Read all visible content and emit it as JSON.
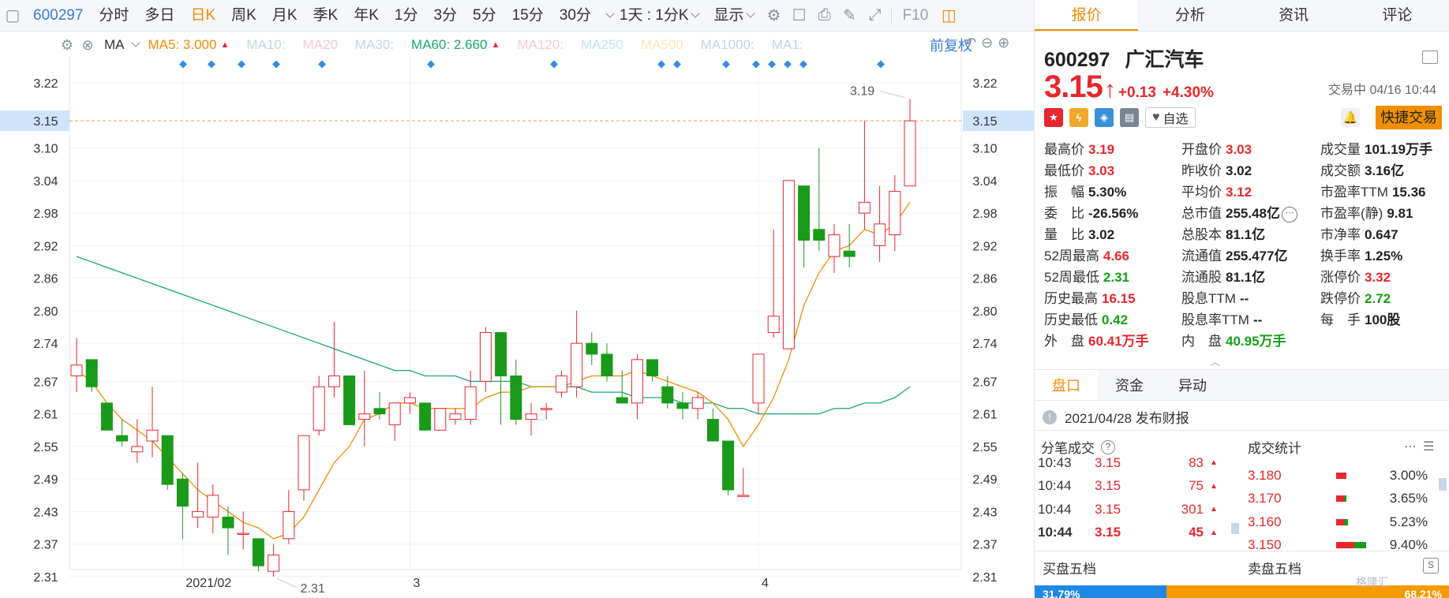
{
  "toolbar": {
    "code": "600297",
    "items": [
      "分时",
      "多日",
      "日K",
      "周K",
      "月K",
      "季K",
      "年K",
      "1分",
      "3分",
      "5分",
      "15分",
      "30分"
    ],
    "active": "日K",
    "interval": "1天 : 1分K",
    "display": "显示",
    "f10": "F10"
  },
  "ma_row": {
    "label": "MA",
    "items": [
      {
        "text": "MA5: 3.000",
        "color": "#f08c00",
        "arrow": true
      },
      {
        "text": "MA10:",
        "color": "#c8d2e6",
        "arrow": false
      },
      {
        "text": "MA20",
        "color": "#f3c9d8",
        "arrow": false
      },
      {
        "text": "MA30:",
        "color": "#c8d2e6",
        "arrow": false
      },
      {
        "text": "MA60: 2.660",
        "color": "#19a86e",
        "arrow": true
      },
      {
        "text": "MA120:",
        "color": "#f3c9d8",
        "arrow": false
      },
      {
        "text": "MA250",
        "color": "#bfe6f3",
        "arrow": false
      },
      {
        "text": "MA500",
        "color": "#f6e6b8",
        "arrow": false
      },
      {
        "text": "MA1000:",
        "color": "#c8d2e6",
        "arrow": false
      },
      {
        "text": "MA1:",
        "color": "#c8d2e6",
        "arrow": false
      }
    ],
    "restore": "前复权"
  },
  "chart_data": {
    "type": "candlestick",
    "y_ticks": [
      "3.22",
      "3.10",
      "3.04",
      "2.98",
      "2.92",
      "2.86",
      "2.80",
      "2.74",
      "2.67",
      "2.61",
      "2.55",
      "2.49",
      "2.43",
      "2.37",
      "2.31"
    ],
    "current_price": "3.15",
    "x_labels": [
      {
        "text": "2021/02",
        "index": 7
      },
      {
        "text": "3",
        "index": 22
      },
      {
        "text": "4",
        "index": 45
      }
    ],
    "high_label": "3.19",
    "low_label": "2.31",
    "candles": [
      {
        "o": 2.68,
        "h": 2.75,
        "l": 2.65,
        "c": 2.7
      },
      {
        "o": 2.71,
        "h": 2.71,
        "l": 2.65,
        "c": 2.66
      },
      {
        "o": 2.63,
        "h": 2.63,
        "l": 2.58,
        "c": 2.58
      },
      {
        "o": 2.57,
        "h": 2.6,
        "l": 2.55,
        "c": 2.56
      },
      {
        "o": 2.54,
        "h": 2.6,
        "l": 2.52,
        "c": 2.55
      },
      {
        "o": 2.56,
        "h": 2.66,
        "l": 2.53,
        "c": 2.58
      },
      {
        "o": 2.57,
        "h": 2.57,
        "l": 2.47,
        "c": 2.48
      },
      {
        "o": 2.49,
        "h": 2.5,
        "l": 2.38,
        "c": 2.44
      },
      {
        "o": 2.42,
        "h": 2.52,
        "l": 2.4,
        "c": 2.43
      },
      {
        "o": 2.42,
        "h": 2.48,
        "l": 2.39,
        "c": 2.46
      },
      {
        "o": 2.42,
        "h": 2.44,
        "l": 2.35,
        "c": 2.4
      },
      {
        "o": 2.39,
        "h": 2.43,
        "l": 2.36,
        "c": 2.39
      },
      {
        "o": 2.38,
        "h": 2.38,
        "l": 2.32,
        "c": 2.33
      },
      {
        "o": 2.32,
        "h": 2.37,
        "l": 2.31,
        "c": 2.35
      },
      {
        "o": 2.38,
        "h": 2.47,
        "l": 2.37,
        "c": 2.43
      },
      {
        "o": 2.47,
        "h": 2.57,
        "l": 2.45,
        "c": 2.57
      },
      {
        "o": 2.58,
        "h": 2.68,
        "l": 2.57,
        "c": 2.66
      },
      {
        "o": 2.66,
        "h": 2.78,
        "l": 2.64,
        "c": 2.68
      },
      {
        "o": 2.68,
        "h": 2.68,
        "l": 2.59,
        "c": 2.59
      },
      {
        "o": 2.6,
        "h": 2.69,
        "l": 2.55,
        "c": 2.61
      },
      {
        "o": 2.62,
        "h": 2.65,
        "l": 2.6,
        "c": 2.61
      },
      {
        "o": 2.59,
        "h": 2.63,
        "l": 2.56,
        "c": 2.63
      },
      {
        "o": 2.63,
        "h": 2.65,
        "l": 2.61,
        "c": 2.64
      },
      {
        "o": 2.63,
        "h": 2.63,
        "l": 2.59,
        "c": 2.58
      },
      {
        "o": 2.58,
        "h": 2.62,
        "l": 2.58,
        "c": 2.62
      },
      {
        "o": 2.6,
        "h": 2.62,
        "l": 2.59,
        "c": 2.61
      },
      {
        "o": 2.6,
        "h": 2.69,
        "l": 2.59,
        "c": 2.66
      },
      {
        "o": 2.67,
        "h": 2.77,
        "l": 2.65,
        "c": 2.76
      },
      {
        "o": 2.76,
        "h": 2.76,
        "l": 2.59,
        "c": 2.68
      },
      {
        "o": 2.68,
        "h": 2.71,
        "l": 2.59,
        "c": 2.6
      },
      {
        "o": 2.6,
        "h": 2.63,
        "l": 2.57,
        "c": 2.61
      },
      {
        "o": 2.62,
        "h": 2.63,
        "l": 2.6,
        "c": 2.62
      },
      {
        "o": 2.65,
        "h": 2.69,
        "l": 2.64,
        "c": 2.68
      },
      {
        "o": 2.66,
        "h": 2.8,
        "l": 2.64,
        "c": 2.74
      },
      {
        "o": 2.74,
        "h": 2.76,
        "l": 2.7,
        "c": 2.72
      },
      {
        "o": 2.72,
        "h": 2.74,
        "l": 2.67,
        "c": 2.68
      },
      {
        "o": 2.64,
        "h": 2.69,
        "l": 2.63,
        "c": 2.63
      },
      {
        "o": 2.63,
        "h": 2.72,
        "l": 2.6,
        "c": 2.71
      },
      {
        "o": 2.71,
        "h": 2.71,
        "l": 2.67,
        "c": 2.68
      },
      {
        "o": 2.66,
        "h": 2.68,
        "l": 2.62,
        "c": 2.63
      },
      {
        "o": 2.63,
        "h": 2.65,
        "l": 2.6,
        "c": 2.62
      },
      {
        "o": 2.62,
        "h": 2.65,
        "l": 2.6,
        "c": 2.64
      },
      {
        "o": 2.6,
        "h": 2.62,
        "l": 2.56,
        "c": 2.56
      },
      {
        "o": 2.56,
        "h": 2.56,
        "l": 2.46,
        "c": 2.47
      },
      {
        "o": 2.46,
        "h": 2.51,
        "l": 2.46,
        "c": 2.46
      },
      {
        "o": 2.63,
        "h": 2.72,
        "l": 2.61,
        "c": 2.72
      },
      {
        "o": 2.76,
        "h": 2.95,
        "l": 2.75,
        "c": 2.79
      },
      {
        "o": 2.73,
        "h": 3.04,
        "l": 2.73,
        "c": 3.04
      },
      {
        "o": 3.03,
        "h": 3.03,
        "l": 2.88,
        "c": 2.93
      },
      {
        "o": 2.95,
        "h": 3.1,
        "l": 2.91,
        "c": 2.93
      },
      {
        "o": 2.9,
        "h": 2.96,
        "l": 2.87,
        "c": 2.94
      },
      {
        "o": 2.91,
        "h": 2.96,
        "l": 2.88,
        "c": 2.9
      },
      {
        "o": 2.98,
        "h": 3.15,
        "l": 2.95,
        "c": 3.0
      },
      {
        "o": 2.92,
        "h": 3.03,
        "l": 2.89,
        "c": 2.96
      },
      {
        "o": 2.94,
        "h": 3.05,
        "l": 2.91,
        "c": 3.02
      },
      {
        "o": 3.03,
        "h": 3.19,
        "l": 3.03,
        "c": 3.15
      }
    ],
    "ma5": [
      2.69,
      2.67,
      2.63,
      2.6,
      2.58,
      2.56,
      2.53,
      2.5,
      2.47,
      2.45,
      2.43,
      2.41,
      2.4,
      2.38,
      2.39,
      2.42,
      2.47,
      2.52,
      2.55,
      2.6,
      2.61,
      2.63,
      2.63,
      2.62,
      2.62,
      2.62,
      2.62,
      2.64,
      2.65,
      2.65,
      2.66,
      2.66,
      2.66,
      2.67,
      2.68,
      2.68,
      2.68,
      2.69,
      2.68,
      2.67,
      2.66,
      2.65,
      2.63,
      2.6,
      2.55,
      2.59,
      2.64,
      2.71,
      2.81,
      2.87,
      2.91,
      2.92,
      2.95,
      2.94,
      2.96,
      3.0
    ],
    "ma60": [
      2.9,
      2.89,
      2.88,
      2.87,
      2.86,
      2.85,
      2.84,
      2.83,
      2.82,
      2.81,
      2.8,
      2.79,
      2.78,
      2.77,
      2.76,
      2.75,
      2.74,
      2.73,
      2.72,
      2.71,
      2.7,
      2.69,
      2.69,
      2.68,
      2.68,
      2.68,
      2.67,
      2.67,
      2.67,
      2.67,
      2.66,
      2.66,
      2.66,
      2.66,
      2.65,
      2.65,
      2.65,
      2.64,
      2.64,
      2.64,
      2.63,
      2.63,
      2.63,
      2.62,
      2.62,
      2.61,
      2.61,
      2.61,
      2.61,
      2.61,
      2.62,
      2.62,
      2.63,
      2.63,
      2.64,
      2.66
    ]
  },
  "right_panel": {
    "tabs": [
      "报价",
      "分析",
      "资讯",
      "评论"
    ],
    "code": "600297",
    "name": "广汇汽车",
    "price": "3.15",
    "change": "+0.13",
    "pct": "+4.30%",
    "trade_time": "交易中 04/16 10:44",
    "watch_label": "自选",
    "fast_trade": "快捷交易",
    "quotes": [
      {
        "k": "最高价",
        "v": "3.19",
        "color": "red"
      },
      {
        "k": "开盘价",
        "v": "3.03",
        "color": "red"
      },
      {
        "k": "成交量",
        "v": "101.19万手",
        "color": "dark"
      },
      {
        "k": "最低价",
        "v": "3.03",
        "color": "red"
      },
      {
        "k": "昨收价",
        "v": "3.02",
        "color": "dark"
      },
      {
        "k": "成交额",
        "v": "3.16亿",
        "color": "dark"
      },
      {
        "k": "振　幅",
        "v": "5.30%",
        "color": "dark"
      },
      {
        "k": "平均价",
        "v": "3.12",
        "color": "red"
      },
      {
        "k": "市盈率TTM",
        "v": "15.36",
        "color": "dark"
      },
      {
        "k": "委　比",
        "v": "-26.56%",
        "color": "dark"
      },
      {
        "k": "总市值",
        "v": "255.48亿",
        "color": "dark",
        "more": true
      },
      {
        "k": "市盈率(静)",
        "v": "9.81",
        "color": "dark"
      },
      {
        "k": "量　比",
        "v": "3.02",
        "color": "dark"
      },
      {
        "k": "总股本",
        "v": "81.1亿",
        "color": "dark"
      },
      {
        "k": "市净率",
        "v": "0.647",
        "color": "dark"
      },
      {
        "k": "52周最高",
        "v": "4.66",
        "color": "red"
      },
      {
        "k": "流通值",
        "v": "255.477亿",
        "color": "dark"
      },
      {
        "k": "换手率",
        "v": "1.25%",
        "color": "dark"
      },
      {
        "k": "52周最低",
        "v": "2.31",
        "color": "green"
      },
      {
        "k": "流通股",
        "v": "81.1亿",
        "color": "dark"
      },
      {
        "k": "涨停价",
        "v": "3.32",
        "color": "red"
      },
      {
        "k": "历史最高",
        "v": "16.15",
        "color": "red"
      },
      {
        "k": "股息TTM",
        "v": "--",
        "color": "dark"
      },
      {
        "k": "跌停价",
        "v": "2.72",
        "color": "green"
      },
      {
        "k": "历史最低",
        "v": "0.42",
        "color": "green"
      },
      {
        "k": "股息率TTM",
        "v": "--",
        "color": "dark"
      },
      {
        "k": "每　手",
        "v": "100股",
        "color": "dark"
      },
      {
        "k": "外　盘",
        "v": "60.41万手",
        "color": "red"
      },
      {
        "k": "内　盘",
        "v": "40.95万手",
        "color": "green"
      }
    ],
    "sub_tabs": [
      "盘口",
      "资金",
      "异动"
    ],
    "notice": "2021/04/28  发布财报",
    "ticks_title": "分笔成交",
    "stats_title": "成交统计",
    "ticks": [
      {
        "t": "10:43",
        "p": "3.15",
        "v": "83"
      },
      {
        "t": "10:44",
        "p": "3.15",
        "v": "75"
      },
      {
        "t": "10:44",
        "p": "3.15",
        "v": "301"
      },
      {
        "t": "10:44",
        "p": "3.15",
        "v": "45"
      }
    ],
    "stats": [
      {
        "p": "3.180",
        "pct": "3.00%",
        "red": 0.28,
        "green": 0
      },
      {
        "p": "3.170",
        "pct": "3.65%",
        "red": 0.22,
        "green": 0.06
      },
      {
        "p": "3.160",
        "pct": "5.23%",
        "red": 0.22,
        "green": 0.1
      },
      {
        "p": "3.150",
        "pct": "9.40%",
        "red": 0.5,
        "green": 0.32
      }
    ],
    "bid_title": "买盘五档",
    "ask_title": "卖盘五档",
    "bid_ratio": "31.79%",
    "ask_ratio": "68.21%",
    "bid_fraction": 0.3179,
    "watermark": "格隆汇"
  }
}
